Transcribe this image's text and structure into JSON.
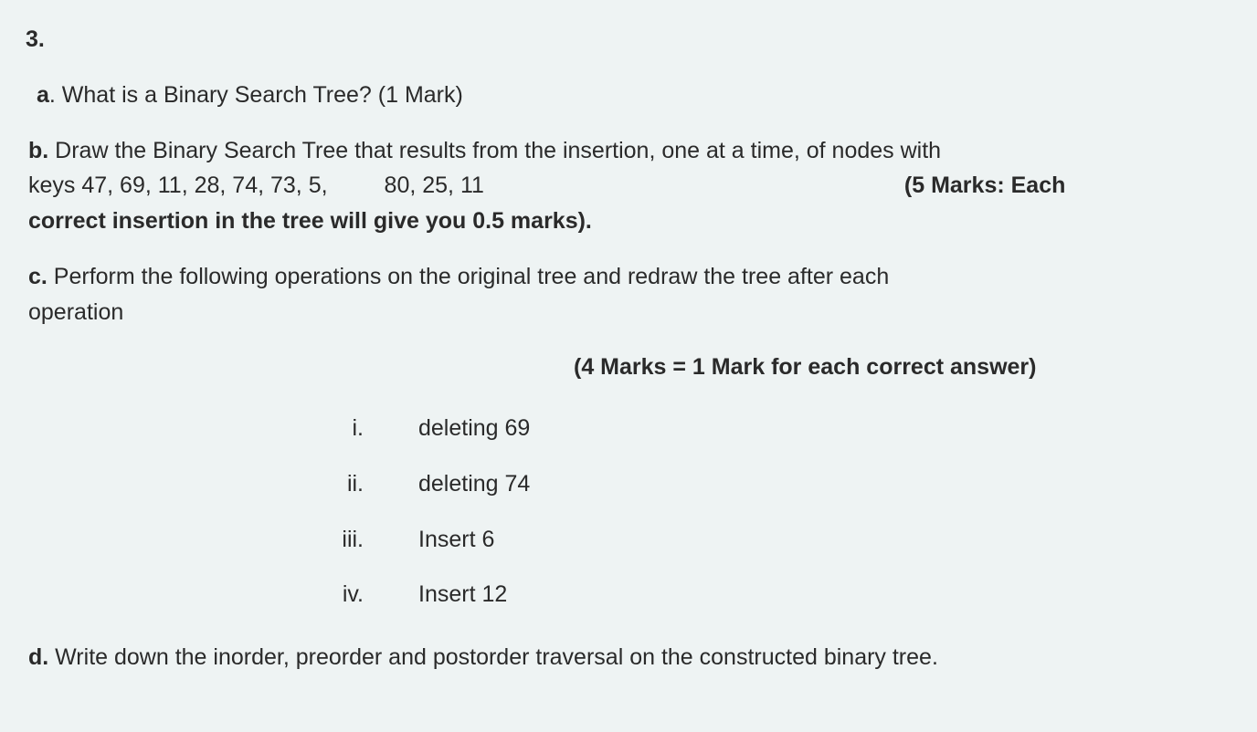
{
  "q_number": "3.",
  "a": {
    "label": "a",
    "text": ". What is a Binary Search Tree? (1 Mark)"
  },
  "b": {
    "label": "b.",
    "line1_part1": " Draw the Binary Search Tree that results from the insertion, one at a time, of nodes with",
    "line2_part1": "keys 47, 69, 11, 28, 74, 73, 5,",
    "line2_part2": "80, 25, 11",
    "line2_part3": "(5 Marks:  Each",
    "line3": "correct insertion in the tree will give you 0.5 marks)."
  },
  "c": {
    "label": "c.",
    "line1": " Perform the following operations on the original tree and redraw the tree after each",
    "line2": "operation",
    "marks_line": "(4 Marks = 1 Mark for each  correct answer)",
    "items": [
      {
        "num": "i.",
        "text": "deleting   69"
      },
      {
        "num": "ii.",
        "text": "deleting   74"
      },
      {
        "num": "iii.",
        "text": "Insert   6"
      },
      {
        "num": "iv.",
        "text": "Insert   12"
      }
    ]
  },
  "d": {
    "label": "d.",
    "text": " Write down the inorder, preorder and postorder traversal on the constructed binary tree."
  }
}
